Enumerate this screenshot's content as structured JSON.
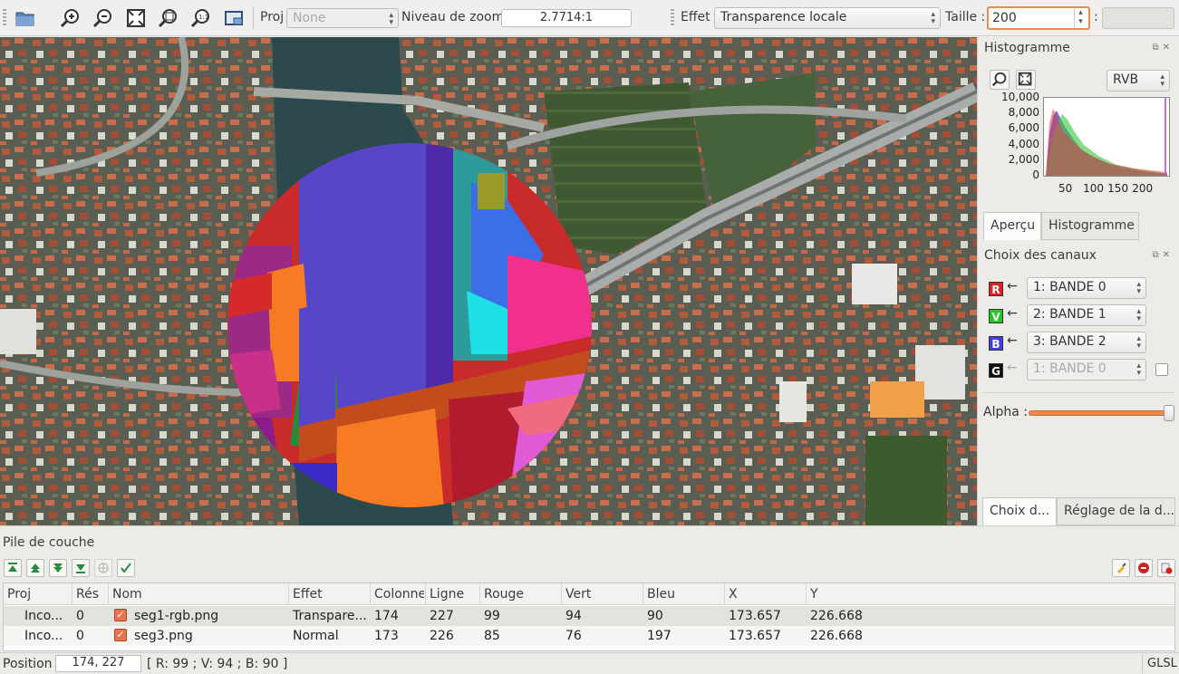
{
  "toolbar": {
    "proj_label": "Proj",
    "proj_value": "None",
    "zoom_label": "Niveau de zoom",
    "zoom_value": "2.7714:1",
    "effect_label": "Effet",
    "effect_value": "Transparence locale",
    "size_label": "Taille :",
    "size_value": "200",
    "colon": ":",
    "icons": [
      "open-folder-icon",
      "zoom-in-icon",
      "zoom-out-icon",
      "zoom-extent-icon",
      "zoom-full-icon",
      "zoom-1-1-icon",
      "screenshot-icon"
    ]
  },
  "histogram_panel": {
    "title": "Histogramme",
    "mode_value": "RVB",
    "y_ticks": [
      "10,000",
      "8,000",
      "6,000",
      "4,000",
      "2,000",
      "0"
    ],
    "x_ticks": [
      "50",
      "100",
      "150",
      "200"
    ],
    "tabs": [
      "Aperçu",
      "Histogramme"
    ]
  },
  "channels_panel": {
    "title": "Choix des canaux",
    "channels": [
      {
        "badge": "R",
        "value": "1: BANDE 0",
        "color": "#e02020"
      },
      {
        "badge": "V",
        "value": "2: BANDE 1",
        "color": "#22c822"
      },
      {
        "badge": "B",
        "value": "3: BANDE 2",
        "color": "#4040e0"
      },
      {
        "badge": "G",
        "value": "1: BANDE 0",
        "color": "#111111"
      }
    ],
    "arrow": "←",
    "alpha_label": "Alpha :",
    "alpha_level": 1.0,
    "tabs": [
      "Choix d...",
      "Réglage de la d..."
    ]
  },
  "layer_stack": {
    "title": "Pile de couche",
    "columns": [
      "Proj",
      "Rés",
      "Nom",
      "Effet",
      "Colonne",
      "Ligne",
      "Rouge",
      "Vert",
      "Bleu",
      "X",
      "Y"
    ],
    "rows": [
      {
        "proj": "Inco...",
        "res": "0",
        "name": "seg1-rgb.png",
        "effect": "Transpare...",
        "col": "174",
        "line": "227",
        "red": "99",
        "green": "94",
        "blue": "90",
        "x": "173.657",
        "y": "226.668"
      },
      {
        "proj": "Inco...",
        "res": "0",
        "name": "seg3.png",
        "effect": "Normal",
        "col": "173",
        "line": "226",
        "red": "85",
        "green": "76",
        "blue": "197",
        "x": "173.657",
        "y": "226.668"
      }
    ]
  },
  "statusbar": {
    "position_label": "Position",
    "position_value": "174, 227",
    "pixel_info": "[ R: 99 ; V: 94 ; B: 90 ]",
    "renderer": "GLSL"
  }
}
